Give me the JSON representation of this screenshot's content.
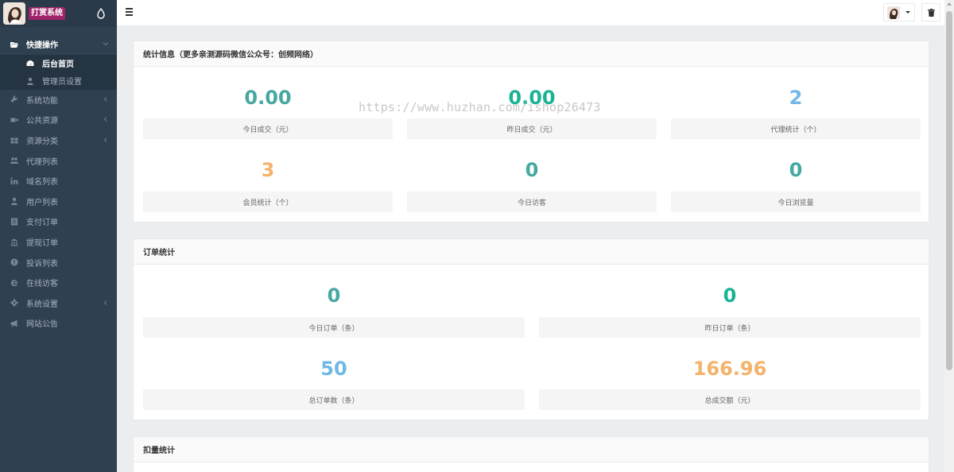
{
  "brand": {
    "title": "打赏系统"
  },
  "sidebar": {
    "items": [
      {
        "label": "快捷操作",
        "icon": "folder-open-icon",
        "active": true,
        "arrow": "down"
      },
      {
        "label": "系统功能",
        "icon": "wrench-icon",
        "arrow": "left"
      },
      {
        "label": "公共资源",
        "icon": "video-icon",
        "arrow": "left"
      },
      {
        "label": "资源分类",
        "icon": "grid-icon",
        "arrow": "left"
      },
      {
        "label": "代理列表",
        "icon": "users-icon"
      },
      {
        "label": "域名列表",
        "icon": "linkedin-icon"
      },
      {
        "label": "用户列表",
        "icon": "user-icon"
      },
      {
        "label": "支付订单",
        "icon": "list-icon"
      },
      {
        "label": "提现订单",
        "icon": "bank-icon"
      },
      {
        "label": "投诉列表",
        "icon": "alert-circle-icon"
      },
      {
        "label": "在线访客",
        "icon": "ie-icon"
      },
      {
        "label": "系统设置",
        "icon": "gear-icon",
        "arrow": "left"
      },
      {
        "label": "网站公告",
        "icon": "bullhorn-icon"
      }
    ],
    "submenu": [
      {
        "label": "后台首页",
        "icon": "dashboard-icon",
        "current": true
      },
      {
        "label": "管理员设置",
        "icon": "user-icon"
      }
    ]
  },
  "panels": {
    "stats": {
      "title": "统计信息（更多亲测源码微信公众号：创频网络）",
      "items": [
        {
          "value": "0.00",
          "label": "今日成交（元）",
          "color": "#46a8a0"
        },
        {
          "value": "0.00",
          "label": "昨日成交（元）",
          "color": "#1ab394"
        },
        {
          "value": "2",
          "label": "代理统计（个）",
          "color": "#70b8e6"
        },
        {
          "value": "3",
          "label": "会员统计（个）",
          "color": "#f4b26b"
        },
        {
          "value": "0",
          "label": "今日访客",
          "color": "#46a8a0"
        },
        {
          "value": "0",
          "label": "今日浏览量",
          "color": "#46a8a0"
        }
      ]
    },
    "orders": {
      "title": "订单统计",
      "items": [
        {
          "value": "0",
          "label": "今日订单（条）",
          "color": "#46a8a0"
        },
        {
          "value": "0",
          "label": "昨日订单（条）",
          "color": "#1ab394"
        },
        {
          "value": "50",
          "label": "总订单数（条）",
          "color": "#70b8e6"
        },
        {
          "value": "166.96",
          "label": "总成交额（元）",
          "color": "#f4b26b"
        }
      ]
    },
    "deduct": {
      "title": "扣量统计"
    }
  },
  "watermark": "https://www.huzhan.com/ishop26473"
}
